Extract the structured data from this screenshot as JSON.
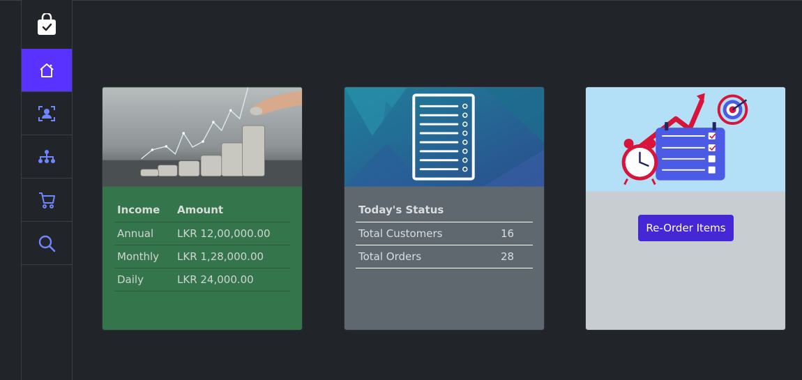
{
  "sidebar": {
    "items": [
      {
        "name": "home",
        "icon": "home-icon",
        "active": true
      },
      {
        "name": "customers",
        "icon": "user-id-icon"
      },
      {
        "name": "hierarchy",
        "icon": "sitemap-icon"
      },
      {
        "name": "cart",
        "icon": "cart-icon"
      },
      {
        "name": "search",
        "icon": "search-icon"
      }
    ],
    "logo_icon": "shopping-bag-check-icon",
    "accent": "#5a32ff"
  },
  "income_card": {
    "headers": {
      "income": "Income",
      "amount": "Amount"
    },
    "rows": [
      {
        "label": "Annual",
        "value": "LKR 12,00,000.00"
      },
      {
        "label": "Monthly",
        "value": "LKR 1,28,000.00"
      },
      {
        "label": "Daily",
        "value": "LKR 24,000.00"
      }
    ],
    "background": "#34754c"
  },
  "status_card": {
    "title": "Today's Status",
    "rows": [
      {
        "label": "Total Customers",
        "value": "16"
      },
      {
        "label": "Total Orders",
        "value": "28"
      }
    ],
    "background": "#5f686e"
  },
  "reorder_card": {
    "button_label": "Re-Order Items",
    "button_color": "#4527d6",
    "background": "#c8cdd1"
  }
}
